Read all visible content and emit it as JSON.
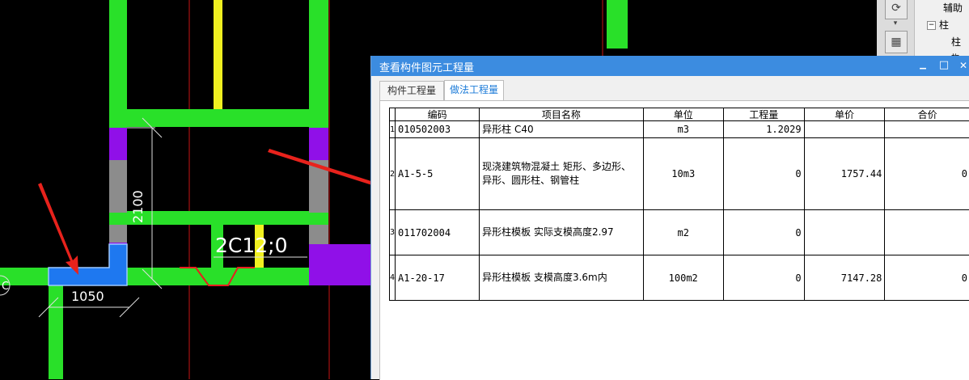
{
  "cad": {
    "dimension_vertical": "2100",
    "dimension_horizontal": "1050",
    "rebar_label": "2C12;0",
    "edge_label": "C"
  },
  "side_panel": {
    "tree_items": [
      "辅助",
      "柱",
      "柱",
      "构"
    ]
  },
  "dialog": {
    "title": "查看构件图元工程量",
    "minimize": "▁",
    "maximize": "□",
    "close": "✕",
    "tabs": [
      {
        "label": "构件工程量",
        "active": false
      },
      {
        "label": "做法工程量",
        "active": true
      }
    ],
    "table": {
      "headers": [
        "编码",
        "项目名称",
        "单位",
        "工程量",
        "单价",
        "合价"
      ],
      "rows": [
        {
          "num": "1",
          "code": "010502003",
          "name": "异形柱 C40",
          "unit": "m3",
          "qty": "1.2029",
          "price": "",
          "total": ""
        },
        {
          "num": "2",
          "code": "A1-5-5",
          "name": "现浇建筑物混凝土 矩形、多边形、异形、圆形柱、钢管柱",
          "unit": "10m3",
          "qty": "0",
          "price": "1757.44",
          "total": "0"
        },
        {
          "num": "3",
          "code": "011702004",
          "name": "异形柱模板 实际支模高度2.97",
          "unit": "m2",
          "qty": "0",
          "price": "",
          "total": ""
        },
        {
          "num": "4",
          "code": "A1-20-17",
          "name": "异形柱模板 支模高度3.6m内",
          "unit": "100m2",
          "qty": "0",
          "price": "7147.28",
          "total": "0"
        }
      ]
    }
  }
}
